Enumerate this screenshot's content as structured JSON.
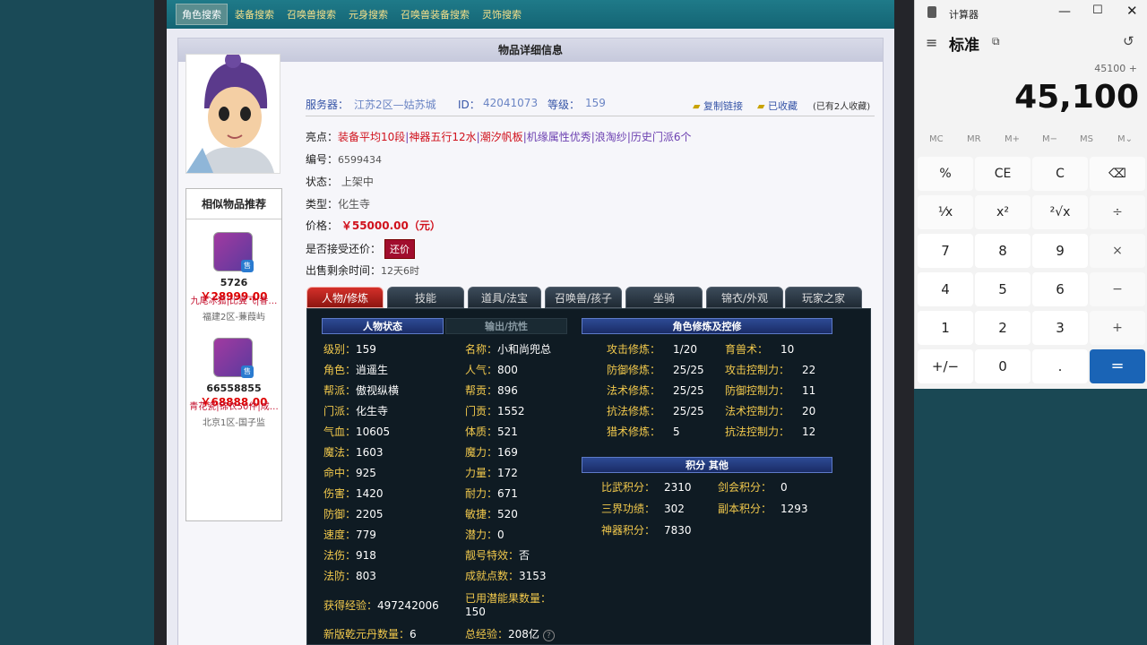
{
  "topnav": [
    "角色搜索",
    "装备搜索",
    "召唤兽搜索",
    "元身搜索",
    "召唤兽装备搜索",
    "灵饰搜索"
  ],
  "panel_title": "物品详细信息",
  "recommend": {
    "title": "相似物品推荐",
    "items": [
      {
        "num": "5726",
        "price": "￥28999.00",
        "tags": "九尾冰狐|比翼飞|眷…",
        "server": "福建2区-蒹葭屿",
        "sale": "售"
      },
      {
        "num": "66558855",
        "price": "￥68888.00",
        "tags": "青花瓷|锦衣50件|成…",
        "server": "北京1区-国子监",
        "sale": "售"
      }
    ]
  },
  "info": {
    "server_label": "服务器：",
    "server": "江苏2区—姑苏城",
    "id_label": "ID：",
    "id": "42041073",
    "level_label": "等级：",
    "level": "159",
    "copy_link": "复制链接",
    "collected": "已收藏",
    "collect_count": "(已有2人收藏)",
    "highlight_label": "亮点：",
    "highlights": [
      "装备平均10段",
      "神器五行12水",
      "潮汐帆板",
      "机缘属性优秀",
      "浪淘纱",
      "历史门派6个"
    ],
    "serial_label": "编号：",
    "serial": "6599434",
    "status_label": "状态：",
    "status": "上架中",
    "type_label": "类型：",
    "type": "化生寺",
    "price_label": "价格：",
    "price": "￥55000.00（元）",
    "counter_label": "是否接受还价：",
    "counter_btn": "还价",
    "time_label": "出售剩余时间：",
    "time": "12天6时"
  },
  "tabs": [
    "人物/修炼",
    "技能",
    "道具/法宝",
    "召唤兽/孩子",
    "坐骑",
    "锦衣/外观",
    "玩家之家"
  ],
  "sections": {
    "char": "人物状态",
    "resist": "输出/抗性",
    "cultivation": "角色修炼及控修",
    "points": "积分  其他"
  },
  "stats_left": [
    [
      "级别：",
      "159"
    ],
    [
      "角色：",
      "逍遥生"
    ],
    [
      "帮派：",
      "傲视纵横"
    ],
    [
      "门派：",
      "化生寺"
    ],
    [
      "气血：",
      "10605"
    ],
    [
      "魔法：",
      "1603"
    ],
    [
      "命中：",
      "925"
    ],
    [
      "伤害：",
      "1420"
    ],
    [
      "防御：",
      "2205"
    ],
    [
      "速度：",
      "779"
    ],
    [
      "法伤：",
      "918"
    ],
    [
      "法防：",
      "803"
    ]
  ],
  "stats_mid": [
    [
      "名称：",
      "小和尚兜总"
    ],
    [
      "人气：",
      "800"
    ],
    [
      "帮贡：",
      "896"
    ],
    [
      "门贡：",
      "1552"
    ],
    [
      "体质：",
      "521"
    ],
    [
      "魔力：",
      "169"
    ],
    [
      "力量：",
      "172"
    ],
    [
      "耐力：",
      "671"
    ],
    [
      "敏捷：",
      "520"
    ],
    [
      "潜力：",
      "0"
    ],
    [
      "靓号特效：",
      "否"
    ],
    [
      "成就点数：",
      "3153"
    ]
  ],
  "exp": {
    "k": "获得经验：",
    "v": "497242006"
  },
  "potential": {
    "k": "已用潜能果数量：",
    "v": "150"
  },
  "qiankun": {
    "k": "新版乾元丹数量：",
    "v": "6"
  },
  "total_exp": {
    "k": "总经验：",
    "v": "208亿"
  },
  "cultivation": [
    [
      "攻击修炼：",
      "1/20",
      "育兽术：",
      "10"
    ],
    [
      "防御修炼：",
      "25/25",
      "攻击控制力：",
      "22"
    ],
    [
      "法术修炼：",
      "25/25",
      "防御控制力：",
      "11"
    ],
    [
      "抗法修炼：",
      "25/25",
      "法术控制力：",
      "20"
    ],
    [
      "猎术修炼：",
      "5",
      "抗法控制力：",
      "12"
    ]
  ],
  "points": [
    [
      "比武积分：",
      "2310",
      "剑会积分：",
      "0"
    ],
    [
      "三界功绩：",
      "302",
      "副本积分：",
      "1293"
    ],
    [
      "神器积分：",
      "7830",
      "",
      ""
    ]
  ],
  "calculator": {
    "title": "计算器",
    "mode": "标准",
    "expression": "45100 +",
    "display": "45,100",
    "memory": [
      "MC",
      "MR",
      "M+",
      "M−",
      "MS",
      "M⌄"
    ],
    "keys": [
      [
        "%",
        "CE",
        "C",
        "⌫"
      ],
      [
        "¹⁄x",
        "x²",
        "²√x",
        "÷"
      ],
      [
        "7",
        "8",
        "9",
        "×"
      ],
      [
        "4",
        "5",
        "6",
        "−"
      ],
      [
        "1",
        "2",
        "3",
        "+"
      ],
      [
        "+/−",
        "0",
        ".",
        "="
      ]
    ]
  }
}
